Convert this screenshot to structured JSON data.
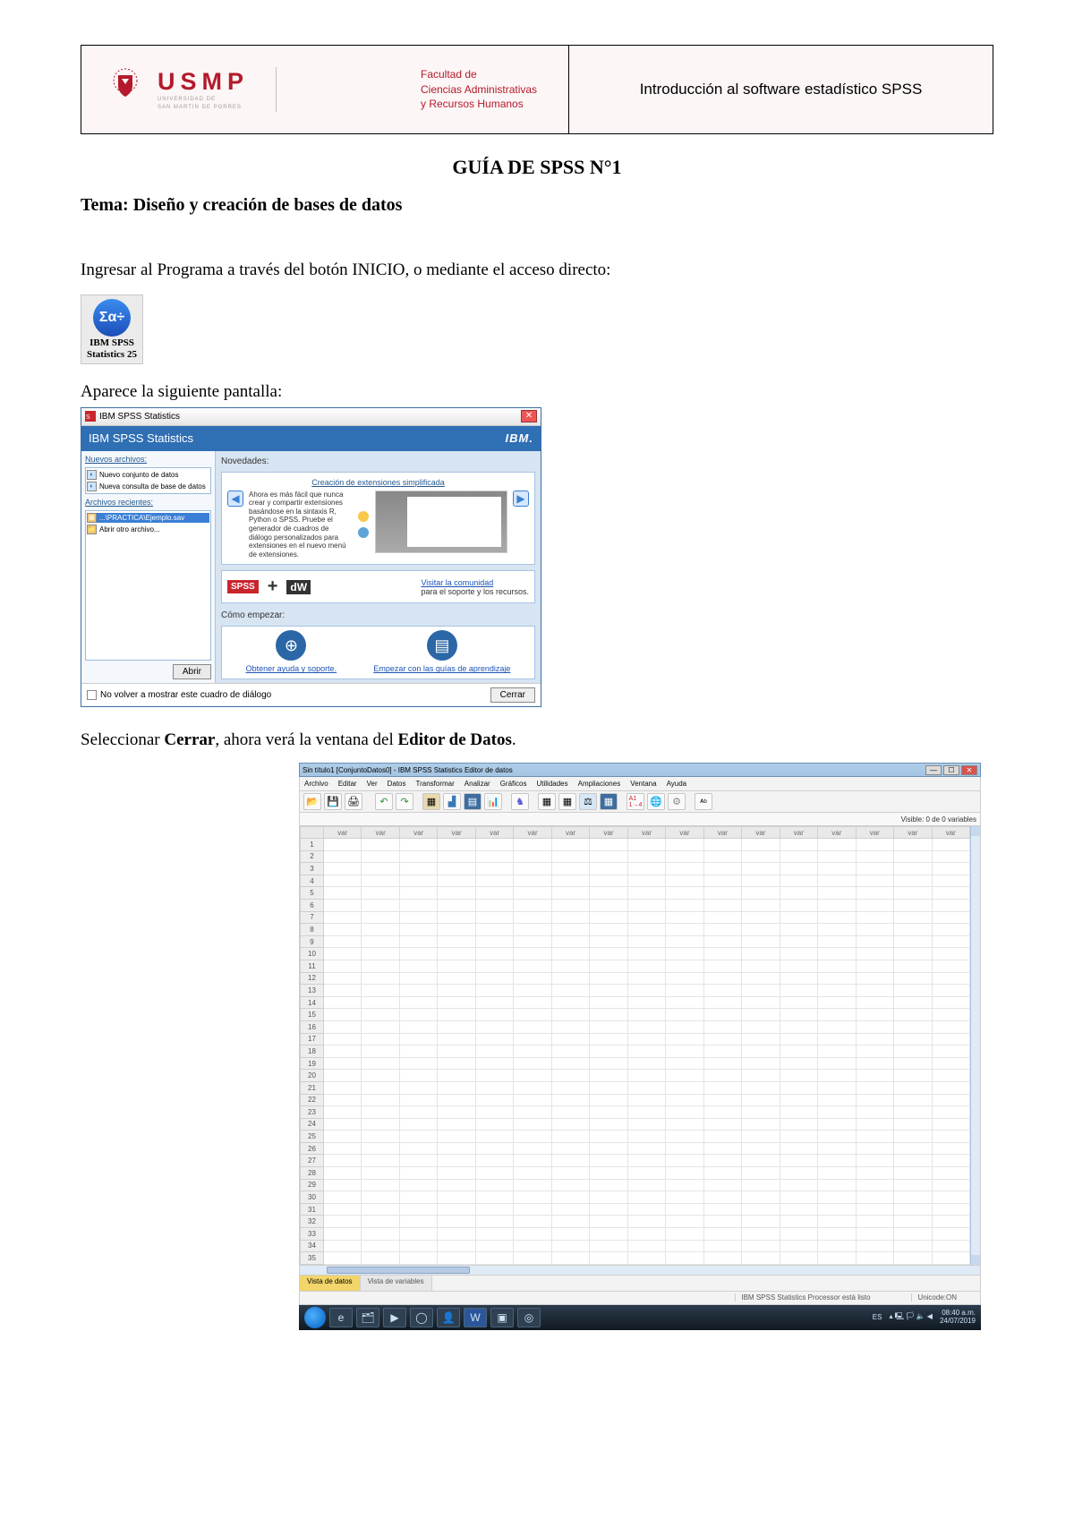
{
  "header": {
    "university_name": "USMP",
    "university_sub1": "UNIVERSIDAD DE",
    "university_sub2": "SAN MARTIN DE PORRES",
    "faculty_l1": "Facultad de",
    "faculty_l2": "Ciencias Administrativas",
    "faculty_l3": "y Recursos Humanos",
    "course": "Introducción al software estadístico SPSS"
  },
  "title": "GUÍA DE SPSS N°1",
  "tema_prefix": "Tema: ",
  "tema": "Diseño y creación de bases de datos",
  "p1": "Ingresar al Programa a través del botón INICIO, o mediante el acceso directo:",
  "shortcut": {
    "sigma": "Σα÷",
    "line1": "IBM SPSS",
    "line2": "Statistics 25"
  },
  "p2": "Aparece la siguiente pantalla:",
  "welcome": {
    "window_title": "IBM SPSS Statistics",
    "brand": "IBM SPSS Statistics",
    "ibm": "IBM.",
    "left": {
      "nuevos_hdr": "Nuevos archivos:",
      "nuevo_conjunto": "Nuevo conjunto de datos",
      "nueva_consulta": "Nueva consulta de base de datos",
      "recientes_hdr": "Archivos recientes:",
      "reciente1": "...\\PRACTICA\\Ejemplo.sav",
      "abrir_otro": "Abrir otro archivo...",
      "abrir_btn": "Abrir"
    },
    "right": {
      "novedades": "Novedades:",
      "ext_link": "Creación de extensiones simplificada",
      "ext_text": "Ahora es más fácil que nunca crear y compartir extensiones basándose en la sintaxis R, Python o SPSS. Pruebe el generador de cuadros de diálogo personalizados para extensiones en el nuevo menú de extensiones.",
      "visitar": "Visitar la comunidad",
      "soporte": "para el soporte y los recursos.",
      "como_empezar": "Cómo empezar:",
      "ayuda_link": "Obtener ayuda y soporte.",
      "guias_link": "Empezar con las guías de aprendizaje"
    },
    "footer": {
      "checkbox": "No volver a mostrar este cuadro de diálogo",
      "close": "Cerrar"
    }
  },
  "p3_a": "Seleccionar ",
  "p3_b": "Cerrar",
  "p3_c": ", ahora verá la ventana del ",
  "p3_d": "Editor de Datos",
  "p3_e": ".",
  "editor": {
    "title": "Sin título1 [ConjuntoDatos0] - IBM SPSS Statistics Editor de datos",
    "menu": [
      "Archivo",
      "Editar",
      "Ver",
      "Datos",
      "Transformar",
      "Analizar",
      "Gráficos",
      "Utilidades",
      "Ampliaciones",
      "Ventana",
      "Ayuda"
    ],
    "visible_vars": "Visible: 0 de 0 variables",
    "col_header": "var",
    "tabs": {
      "data": "Vista de datos",
      "vars": "Vista de variables"
    },
    "status": {
      "processor": "IBM SPSS Statistics Processor está listo",
      "unicode": "Unicode:ON"
    },
    "taskbar_time": "08:40 a.m.",
    "taskbar_date": "24/07/2019",
    "taskbar_lang": "ES"
  }
}
